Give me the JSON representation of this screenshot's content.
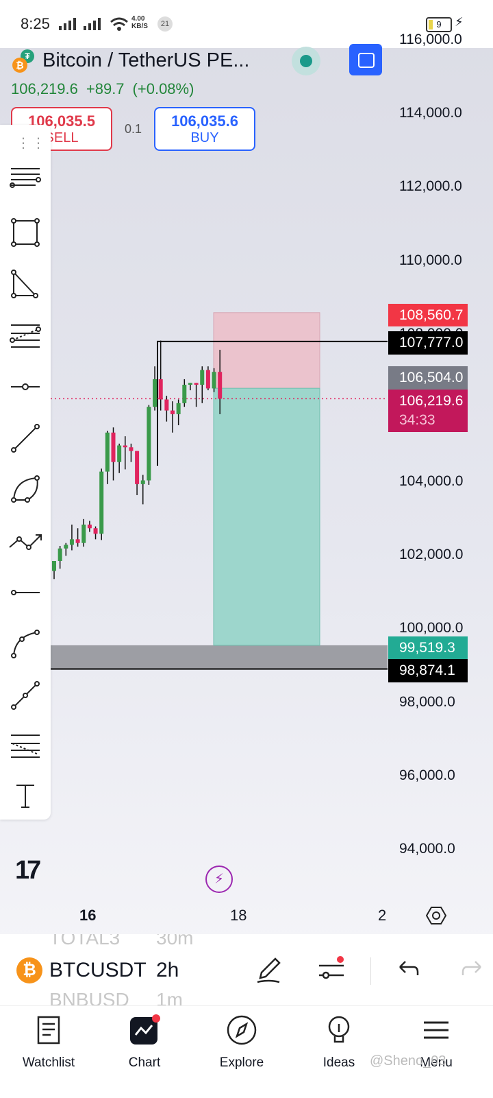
{
  "status_bar": {
    "time": "8:25",
    "net_speed": "4.00",
    "net_unit": "KB/S",
    "notif_count": "21",
    "battery": "9"
  },
  "header": {
    "title": "Bitcoin / TetherUS PE...",
    "last_price": "106,219.6",
    "change": "+89.7",
    "change_pct": "(+0.08%)",
    "sell_price": "106,035.5",
    "sell_label": "SELL",
    "spread": "0.1",
    "buy_price": "106,035.6",
    "buy_label": "BUY"
  },
  "toolbar": {
    "tools": [
      "menu-lines-icon",
      "rectangle-icon",
      "triangle-icon",
      "fib-retracement-icon",
      "horizontal-ray-icon",
      "trend-line-icon",
      "arc-icon",
      "path-icon",
      "horizontal-line-icon",
      "curve-icon",
      "polyline-icon",
      "fib-extension-icon",
      "text-icon"
    ]
  },
  "price_axis": {
    "labels": [
      "116,000.0",
      "114,000.0",
      "112,000.0",
      "110,000.0",
      "104,000.0",
      "102,000.0",
      "100,000.0",
      "98,000.0",
      "96,000.0",
      "94,000.0"
    ],
    "partial_label": "108,000.0"
  },
  "price_tags": {
    "stop": "108,560.7",
    "level_top": "107,777.0",
    "entry": "106,504.0",
    "current": "106,219.6",
    "countdown": "34:33",
    "target": "99,519.3",
    "level_bottom": "98,874.1"
  },
  "colors": {
    "up": "#3a9a4a",
    "down": "#e0245e",
    "stop_zone": "#ebc3cd",
    "target_zone": "#9dd6cc",
    "accent": "#2962ff"
  },
  "time_axis": {
    "labels": [
      "16",
      "18",
      "2"
    ]
  },
  "symbol_bar": {
    "ghost_top_symbol": "TOTAL3",
    "ghost_top_tf": "30m",
    "symbol": "BTCUSDT",
    "timeframe": "2h",
    "ghost_bottom_symbol": "BNBUSD",
    "ghost_bottom_tf": "1m"
  },
  "nav": {
    "watchlist": "Watchlist",
    "chart": "Chart",
    "explore": "Explore",
    "ideas": "Ideas",
    "menu": "Menu"
  },
  "watermark": "@Sheno_03",
  "candles": [
    {
      "o": 101540,
      "h": 101810,
      "l": 101320,
      "c": 101810
    },
    {
      "o": 101810,
      "h": 102220,
      "l": 101600,
      "c": 102150
    },
    {
      "o": 102150,
      "h": 102300,
      "l": 101950,
      "c": 102250
    },
    {
      "o": 102250,
      "h": 102800,
      "l": 102100,
      "c": 102400
    },
    {
      "o": 102400,
      "h": 102700,
      "l": 102200,
      "c": 102300
    },
    {
      "o": 102300,
      "h": 102950,
      "l": 102200,
      "c": 102800
    },
    {
      "o": 102800,
      "h": 102900,
      "l": 102600,
      "c": 102700
    },
    {
      "o": 102700,
      "h": 102750,
      "l": 102400,
      "c": 102550
    },
    {
      "o": 102550,
      "h": 104320,
      "l": 102380,
      "c": 104240
    },
    {
      "o": 104240,
      "h": 105350,
      "l": 103900,
      "c": 105300
    },
    {
      "o": 105300,
      "h": 105440,
      "l": 104000,
      "c": 104500
    },
    {
      "o": 104500,
      "h": 105000,
      "l": 104200,
      "c": 104950
    },
    {
      "o": 104950,
      "h": 105200,
      "l": 104300,
      "c": 104900
    },
    {
      "o": 104900,
      "h": 105000,
      "l": 104500,
      "c": 104800
    },
    {
      "o": 104800,
      "h": 104800,
      "l": 103600,
      "c": 103900
    },
    {
      "o": 103900,
      "h": 104150,
      "l": 103350,
      "c": 104000
    },
    {
      "o": 104000,
      "h": 106050,
      "l": 103880,
      "c": 106000
    },
    {
      "o": 106000,
      "h": 107100,
      "l": 105900,
      "c": 106750
    },
    {
      "o": 106750,
      "h": 107800,
      "l": 105900,
      "c": 106200
    },
    {
      "o": 106200,
      "h": 106300,
      "l": 105600,
      "c": 105900
    },
    {
      "o": 105900,
      "h": 106150,
      "l": 105300,
      "c": 105800
    },
    {
      "o": 105800,
      "h": 106200,
      "l": 105500,
      "c": 106100
    },
    {
      "o": 106100,
      "h": 106750,
      "l": 106000,
      "c": 106600
    },
    {
      "o": 106600,
      "h": 106650,
      "l": 106450,
      "c": 106650
    },
    {
      "o": 106650,
      "h": 106650,
      "l": 106000,
      "c": 106600
    },
    {
      "o": 106600,
      "h": 107100,
      "l": 106100,
      "c": 107000
    },
    {
      "o": 107000,
      "h": 107100,
      "l": 106450,
      "c": 106500
    },
    {
      "o": 106500,
      "h": 107050,
      "l": 106400,
      "c": 106950
    },
    {
      "o": 106950,
      "h": 107550,
      "l": 105800,
      "c": 106220
    }
  ]
}
